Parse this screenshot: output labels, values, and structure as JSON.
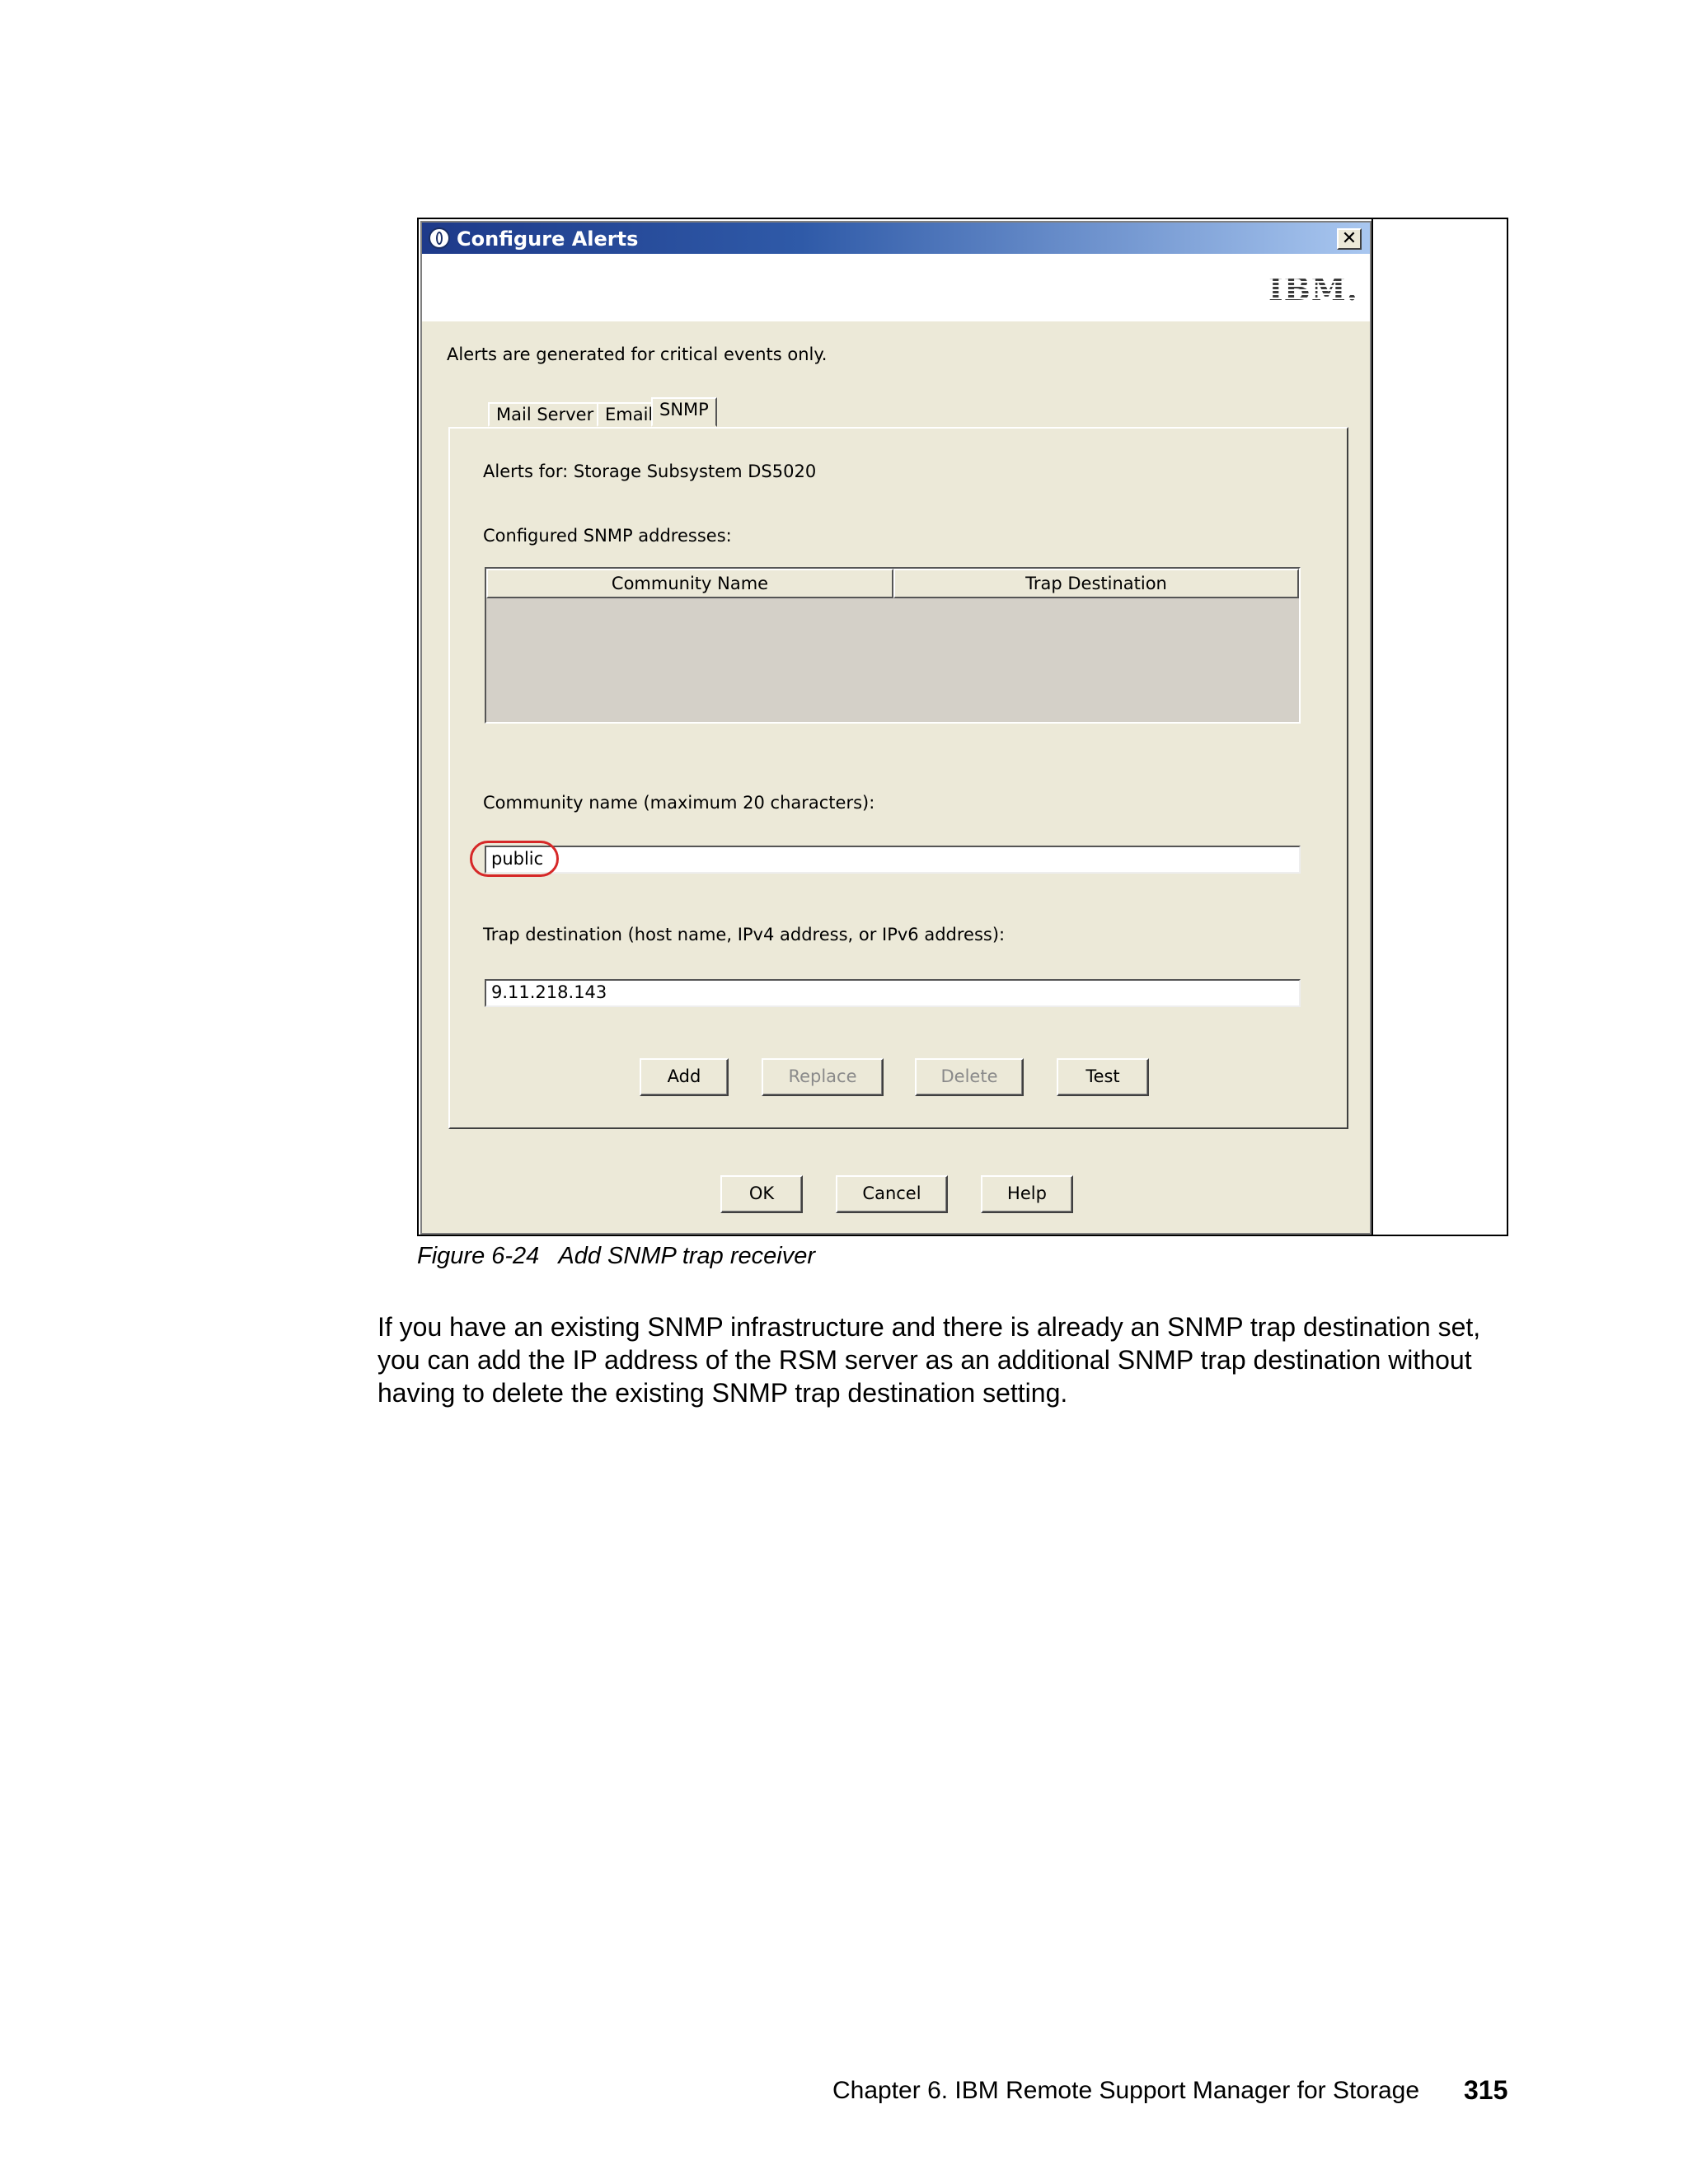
{
  "dialog": {
    "title": "Configure Alerts",
    "close_symbol": "✕",
    "logo_text": "IBM.",
    "info_text": "Alerts are generated for critical events only.",
    "tabs": [
      {
        "label": "Mail Server"
      },
      {
        "label": "Email"
      },
      {
        "label": "SNMP"
      }
    ],
    "panel": {
      "alerts_for": "Alerts for: Storage Subsystem DS5020",
      "configured_label": "Configured SNMP addresses:",
      "table_headers": [
        "Community Name",
        "Trap Destination"
      ],
      "community_label": "Community name (maximum 20 characters):",
      "community_value": "public",
      "trap_label": "Trap destination (host name, IPv4 address, or IPv6 address):",
      "trap_value": "9.11.218.143",
      "buttons": {
        "add": "Add",
        "replace": "Replace",
        "delete": "Delete",
        "test": "Test"
      }
    },
    "footer_buttons": {
      "ok": "OK",
      "cancel": "Cancel",
      "help": "Help"
    }
  },
  "caption": "Figure 6-24   Add SNMP trap receiver",
  "body_paragraph": "If you have an existing SNMP infrastructure and there is already an SNMP trap destination set, you can add the IP address of the RSM server as an additional SNMP trap destination without having to delete the existing SNMP trap destination setting.",
  "footer": {
    "chapter": "Chapter 6. IBM Remote Support Manager for Storage",
    "page_number": "315"
  },
  "colors": {
    "highlight": "#d62828",
    "titlebar": "#2f5aa8",
    "dialog_bg": "#ece9d8"
  }
}
